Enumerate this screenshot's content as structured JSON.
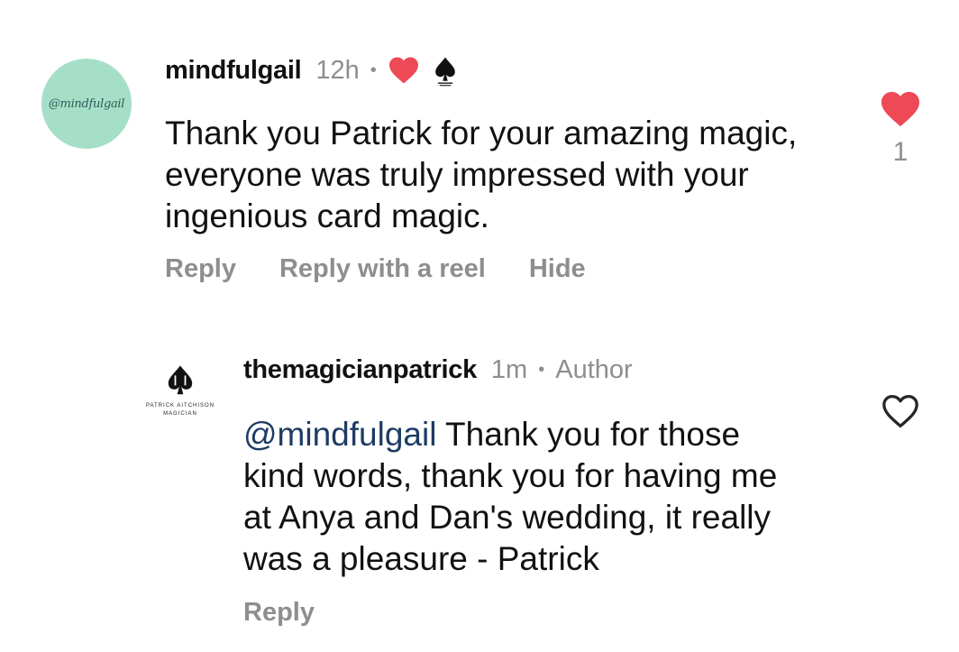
{
  "comments": [
    {
      "username": "mindfulgail",
      "avatar_text": "@mindfulgail",
      "time": "12h",
      "separator": "•",
      "line1": "Thank you Patrick for your amazing magic,",
      "line2": "everyone was truly impressed with your",
      "line3": "ingenious card  magic.",
      "actions": {
        "reply": "Reply",
        "reply_reel": "Reply with a reel",
        "hide": "Hide"
      },
      "like_count": "1",
      "liked": true,
      "creator_liked": true
    },
    {
      "username": "themagicianpatrick",
      "avatar_text_top": "PATRICK AITCHISON",
      "avatar_text_bottom": "MAGICIAN",
      "time": "1m",
      "separator": "•",
      "badge": "Author",
      "mention": "@mindfulgail",
      "line1_rest": " Thank you for those",
      "line2": "kind words, thank you for having me",
      "line3": "at Anya and Dan's wedding, it really",
      "line4": "was a pleasure - Patrick",
      "actions": {
        "reply": "Reply"
      },
      "liked": false
    }
  ],
  "colors": {
    "heart": "#ed4956",
    "muted": "#8e8e8e",
    "mention": "#1d3c64",
    "avatar_bg": "#a6dfc8"
  },
  "icons": [
    "heart-filled-icon",
    "heart-outline-icon",
    "spade-logo-icon"
  ]
}
